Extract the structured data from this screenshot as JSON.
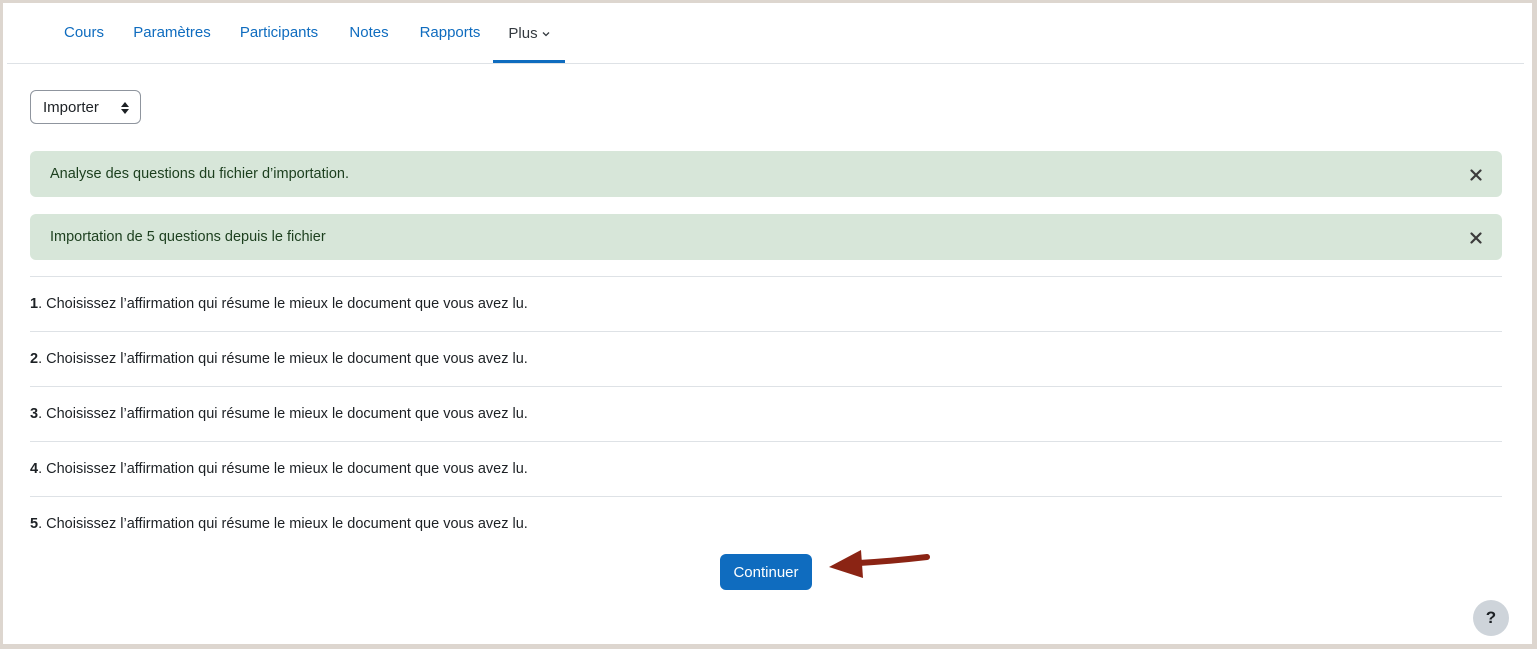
{
  "nav": {
    "items": [
      {
        "label": "Cours"
      },
      {
        "label": "Paramètres"
      },
      {
        "label": "Participants"
      },
      {
        "label": "Notes"
      },
      {
        "label": "Rapports"
      },
      {
        "label": "Plus",
        "active": true
      }
    ]
  },
  "action_select": {
    "selected": "Importer"
  },
  "alerts": [
    {
      "message": "Analyse des questions du fichier d’importation."
    },
    {
      "message": "Importation de 5 questions depuis le fichier"
    }
  ],
  "questions": [
    {
      "number": "1",
      "text": ". Choisissez l’affirmation qui résume le mieux le document que vous avez lu."
    },
    {
      "number": "2",
      "text": ". Choisissez l’affirmation qui résume le mieux le document que vous avez lu."
    },
    {
      "number": "3",
      "text": ". Choisissez l’affirmation qui résume le mieux le document que vous avez lu."
    },
    {
      "number": "4",
      "text": ". Choisissez l’affirmation qui résume le mieux le document que vous avez lu."
    },
    {
      "number": "5",
      "text": ". Choisissez l’affirmation qui résume le mieux le document que vous avez lu."
    }
  ],
  "continue_button": {
    "label": "Continuer"
  },
  "help_button": {
    "label": "?"
  },
  "colors": {
    "primary": "#0f6cbf",
    "alert_success_bg": "#d7e6d9",
    "annotation_arrow": "#8b2414"
  }
}
